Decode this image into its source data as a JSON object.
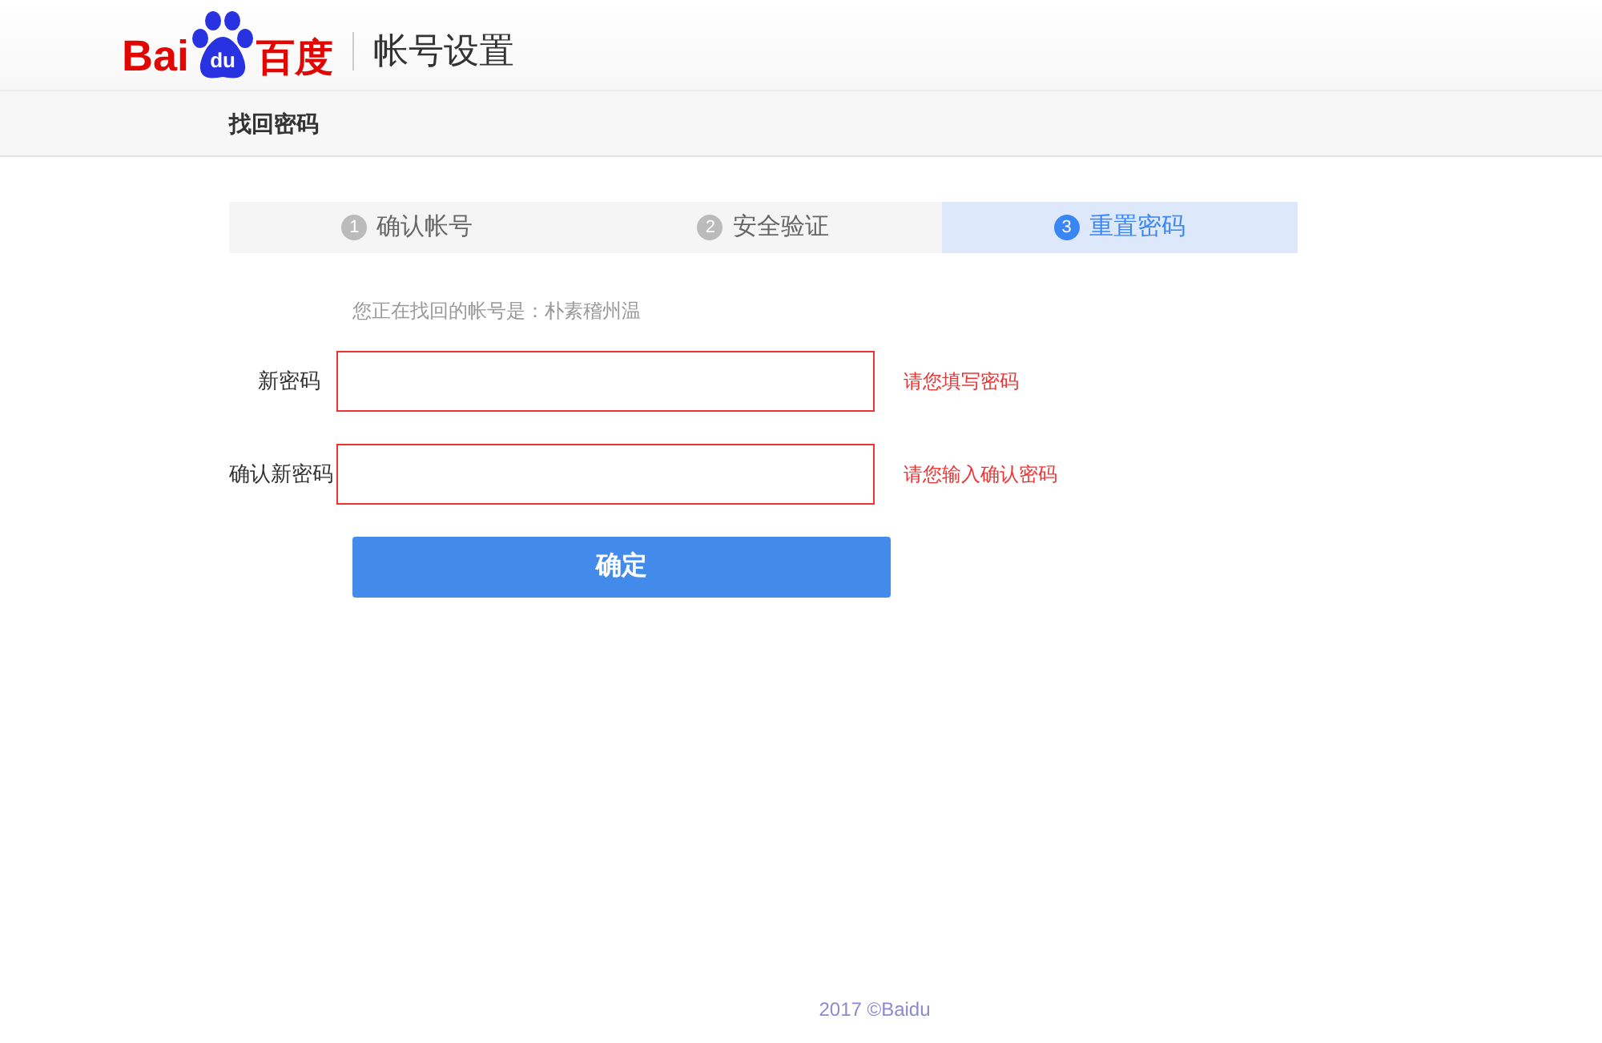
{
  "header": {
    "logo": {
      "left": "Bai",
      "paw": "du",
      "right": "百度"
    },
    "title": "帐号设置"
  },
  "subnav": {
    "title": "找回密码"
  },
  "steps": [
    {
      "number": "1",
      "label": "确认帐号",
      "selected": false
    },
    {
      "number": "2",
      "label": "安全验证",
      "selected": false
    },
    {
      "number": "3",
      "label": "重置密码",
      "selected": true
    }
  ],
  "account_note": "您正在找回的帐号是：朴素稽州温",
  "fields": [
    {
      "label": "新密码",
      "error": true,
      "message": "请您填写密码"
    },
    {
      "label": "确认新密码",
      "error": true,
      "message": "请您输入确认密码"
    }
  ],
  "submit": "确定",
  "footer": "2017 ©Baidu"
}
